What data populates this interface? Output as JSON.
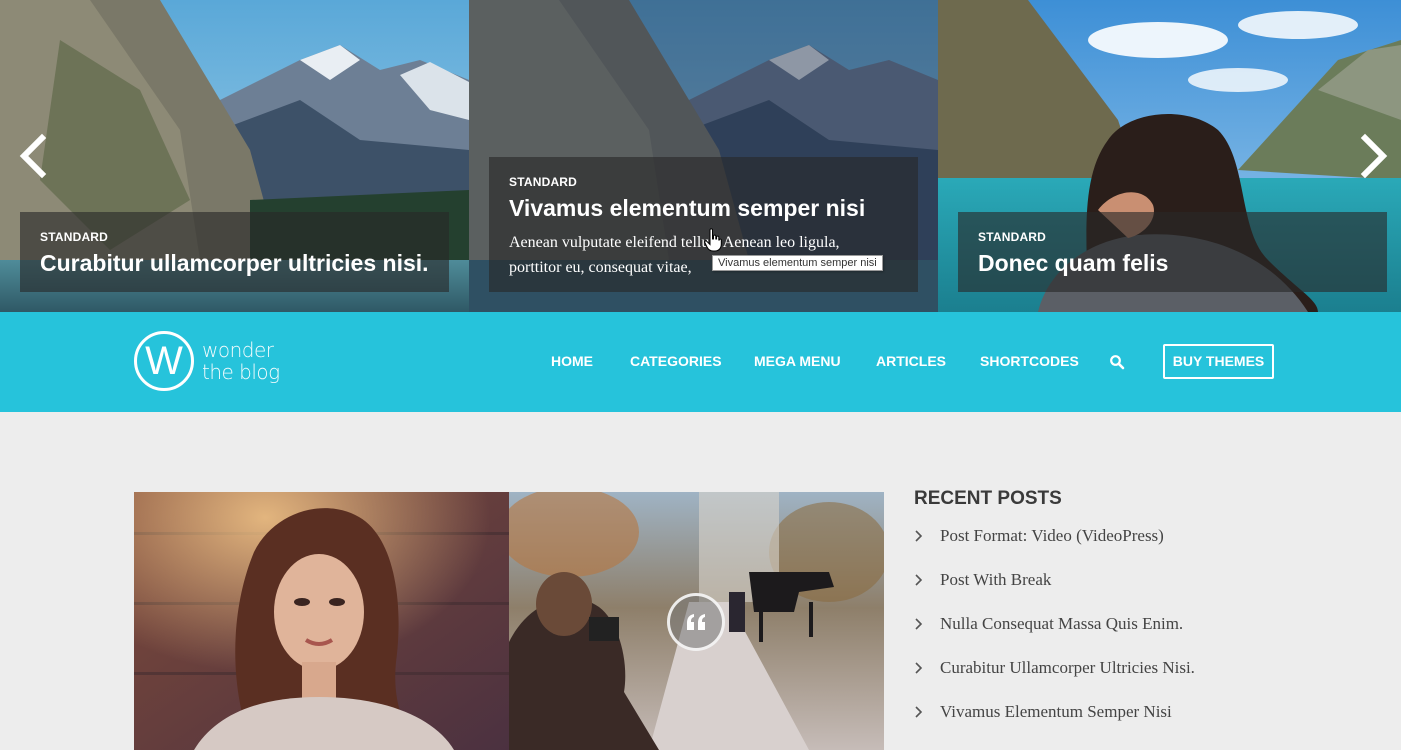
{
  "slider": {
    "slides": [
      {
        "category": "STANDARD",
        "title": "Curabitur ullamcorper ultricies nisi."
      },
      {
        "category": "STANDARD",
        "title": "Vivamus elementum semper nisi",
        "excerpt_line1": "Aenean vulputate eleifend tellus. Aenean leo ligula,",
        "excerpt_line2": "porttitor eu, consequat vitae,"
      },
      {
        "category": "STANDARD",
        "title": "Donec quam felis"
      }
    ],
    "tooltip": "Vivamus elementum semper nisi",
    "prev_icon": "chevron-left-icon",
    "next_icon": "chevron-right-icon"
  },
  "header": {
    "logo_letter": "W",
    "logo_line1": "wonder",
    "logo_line2": "the blog",
    "nav": [
      "HOME",
      "CATEGORIES",
      "MEGA MENU",
      "ARTICLES",
      "SHORTCODES"
    ],
    "search_icon": "search-icon",
    "buy_button": "BUY THEMES",
    "color": "#26c3db"
  },
  "sidebar": {
    "title": "RECENT POSTS",
    "items": [
      "Post Format: Video (VideoPress)",
      "Post With Break",
      "Nulla Consequat Massa Quis Enim.",
      "Curabitur Ullamcorper Ultricies Nisi.",
      "Vivamus Elementum Semper Nisi"
    ]
  },
  "posts": {
    "quote_icon": "quote-icon"
  }
}
